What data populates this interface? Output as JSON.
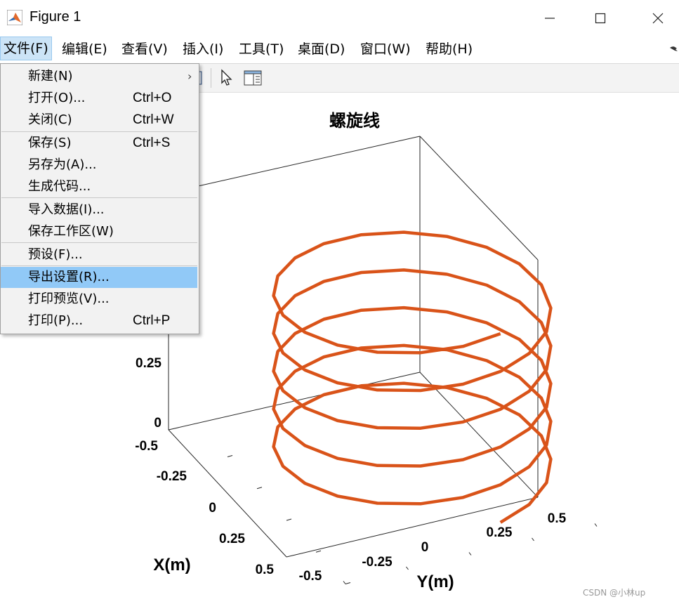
{
  "window": {
    "title": "Figure 1",
    "controls": [
      "minimize",
      "maximize",
      "close"
    ]
  },
  "menubar": {
    "items": [
      "文件(F)",
      "编辑(E)",
      "查看(V)",
      "插入(I)",
      "工具(T)",
      "桌面(D)",
      "窗口(W)",
      "帮助(H)"
    ],
    "active": "文件(F)"
  },
  "file_menu": {
    "items": [
      {
        "label": "新建(N)",
        "shortcut": "",
        "submenu": true
      },
      {
        "label": "打开(O)...",
        "shortcut": "Ctrl+O"
      },
      {
        "label": "关闭(C)",
        "shortcut": "Ctrl+W"
      },
      {
        "label": "保存(S)",
        "shortcut": "Ctrl+S"
      },
      {
        "label": "另存为(A)...",
        "shortcut": ""
      },
      {
        "label": "生成代码...",
        "shortcut": ""
      },
      {
        "label": "导入数据(I)...",
        "shortcut": ""
      },
      {
        "label": "保存工作区(W)",
        "shortcut": ""
      },
      {
        "label": "预设(F)...",
        "shortcut": ""
      },
      {
        "label": "导出设置(R)...",
        "shortcut": "",
        "highlighted": true
      },
      {
        "label": "打印预览(V)...",
        "shortcut": ""
      },
      {
        "label": "打印(P)...",
        "shortcut": "Ctrl+P"
      }
    ],
    "submenu_arrow": "›"
  },
  "toolbar": {
    "icons": [
      "pointer-arrow-icon",
      "property-inspector-icon"
    ]
  },
  "chart_data": {
    "type": "line",
    "title": "螺旋线",
    "xlabel": "X(m)",
    "ylabel": "Y(m)",
    "zlabel": "",
    "xlim": [
      -0.5,
      0.5
    ],
    "ylim": [
      -0.5,
      0.5
    ],
    "zlim": [
      0,
      1
    ],
    "x_ticks": [
      "-0.5",
      "-0.25",
      "0",
      "0.25",
      "0.5"
    ],
    "y_ticks": [
      "-0.5",
      "-0.25",
      "0",
      "0.25",
      "0.5"
    ],
    "z_ticks_visible": [
      "0",
      "0.25"
    ],
    "series": [
      {
        "description_of_curve": "helix x=0.5cos(t), y=0.5sin(t), z rising",
        "turns": 5,
        "radius": 0.5,
        "color": "#D95319"
      }
    ],
    "grid": false,
    "box": true
  },
  "colors": {
    "line": "#D95319",
    "menu_highlight": "#91c9f7",
    "menubar_active": "#cce4f7"
  },
  "watermark": "CSDN @小林up"
}
